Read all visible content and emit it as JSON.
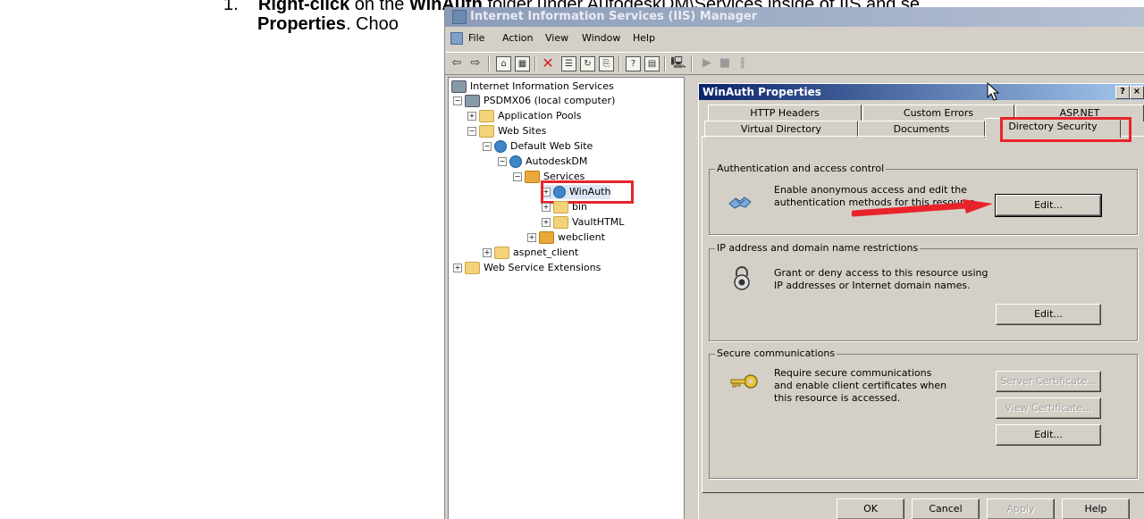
{
  "doc": {
    "step_number": "1.",
    "line1_bold_a": "Right-click",
    "line1_mid": " on the ",
    "line1_bold_b": "WinAuth",
    "line1_rest": " folder under AutodeskDM\\Services inside of IIS and se",
    "line2_bold": "Properties",
    "line2_rest": ". Choo"
  },
  "window": {
    "title": "Internet Information Services (IIS) Manager",
    "menu": [
      "File",
      "Action",
      "View",
      "Window",
      "Help"
    ]
  },
  "tree": [
    {
      "label": "Internet Information Services",
      "icon": "iis-icon"
    },
    {
      "label": "PSDMX06 (local computer)",
      "icon": "server-icon"
    },
    {
      "label": "Application Pools",
      "icon": "folder-icon"
    },
    {
      "label": "Web Sites",
      "icon": "folder-icon"
    },
    {
      "label": "Default Web Site",
      "icon": "globe-icon"
    },
    {
      "label": "AutodeskDM",
      "icon": "globe-icon"
    },
    {
      "label": "Services",
      "icon": "package-icon"
    },
    {
      "label": "WinAuth",
      "icon": "globe-icon"
    },
    {
      "label": "bin",
      "icon": "folder-icon"
    },
    {
      "label": "VaultHTML",
      "icon": "folder-icon"
    },
    {
      "label": "webclient",
      "icon": "package-icon"
    },
    {
      "label": "aspnet_client",
      "icon": "folder-icon"
    },
    {
      "label": "Web Service Extensions",
      "icon": "folder-icon"
    }
  ],
  "dialog": {
    "title": "WinAuth Properties",
    "help_label": "?",
    "close_label": "×",
    "tabs_back": [
      "HTTP Headers",
      "Custom Errors",
      "ASP.NET"
    ],
    "tabs_front": [
      "Virtual Directory",
      "Documents",
      "Directory Security"
    ],
    "active_tab": "Directory Security",
    "auth": {
      "legend": "Authentication and access control",
      "text": "Enable anonymous access and edit the authentication methods for this resource.",
      "edit": "Edit..."
    },
    "ip": {
      "legend": "IP address and domain name restrictions",
      "text": "Grant or deny access to this resource using IP addresses or Internet domain names.",
      "edit": "Edit..."
    },
    "secure": {
      "legend": "Secure communications",
      "text": "Require secure communications and enable client certificates when this resource is accessed.",
      "server_cert": "Server Certificate...",
      "view_cert": "View Certificate...",
      "edit": "Edit..."
    },
    "buttons": {
      "ok": "OK",
      "cancel": "Cancel",
      "apply": "Apply",
      "help": "Help"
    }
  },
  "colors": {
    "highlight": "#e8232a",
    "dialog_title": "#0a246a",
    "window_face": "#d4d0c8"
  }
}
